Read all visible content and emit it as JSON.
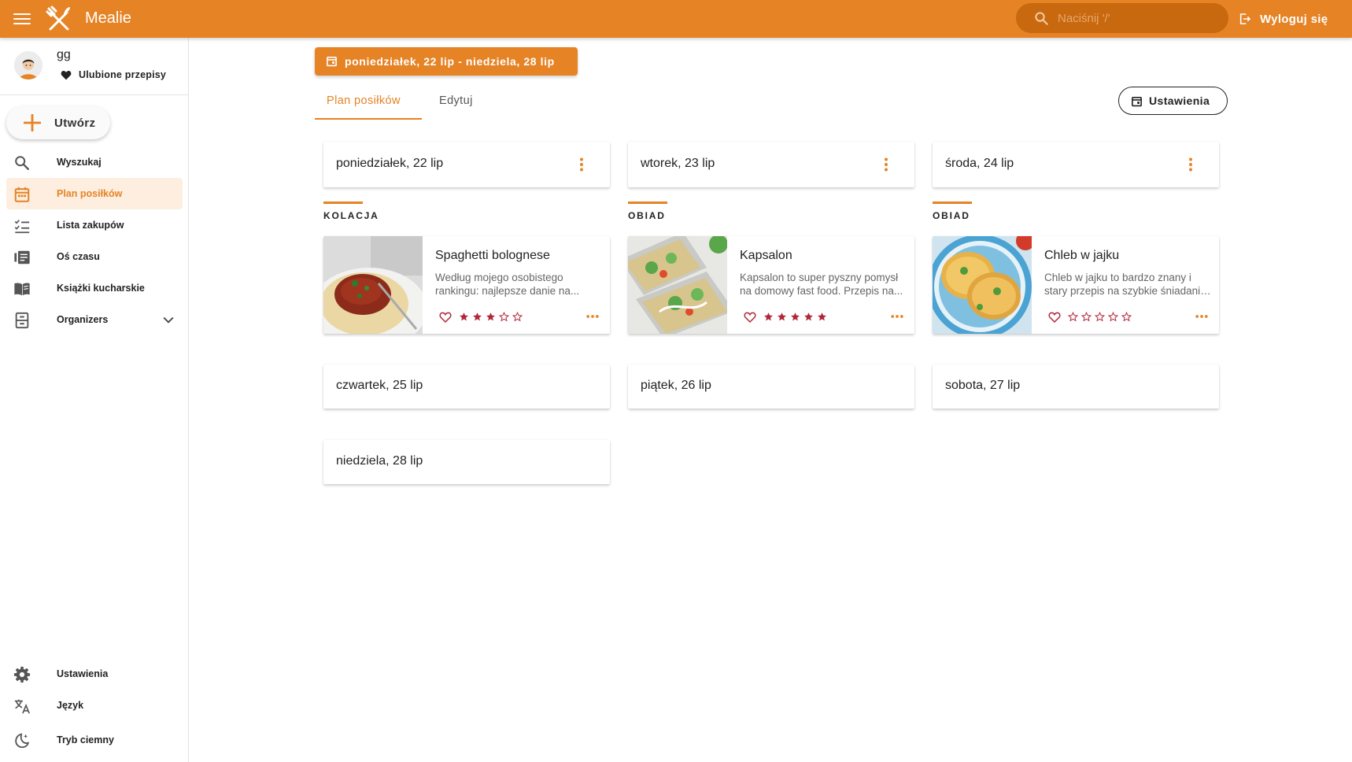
{
  "app": {
    "title": "Mealie"
  },
  "search": {
    "placeholder": "Naciśnij '/'"
  },
  "header": {
    "logout_label": "Wyloguj się"
  },
  "user": {
    "name": "gg",
    "favorites_label": "Ulubione przepisy"
  },
  "sidebar": {
    "create_label": "Utwórz",
    "items": [
      {
        "label": "Wyszukaj",
        "icon": "search-icon",
        "active": false
      },
      {
        "label": "Plan posiłków",
        "icon": "calendar-icon",
        "active": true
      },
      {
        "label": "Lista zakupów",
        "icon": "checklist-icon",
        "active": false
      },
      {
        "label": "Oś czasu",
        "icon": "timeline-icon",
        "active": false
      },
      {
        "label": "Książki kucharskie",
        "icon": "book-icon",
        "active": false
      },
      {
        "label": "Organizers",
        "icon": "organizer-icon",
        "active": false
      }
    ],
    "bottom_items": [
      {
        "label": "Ustawienia",
        "icon": "gear-icon"
      },
      {
        "label": "Język",
        "icon": "translate-icon"
      },
      {
        "label": "Tryb ciemny",
        "icon": "dark-mode-icon"
      }
    ]
  },
  "main": {
    "date_range": "poniedziałek, 22 lip - niedziela, 28 lip",
    "tabs": [
      {
        "label": "Plan posiłków",
        "active": true
      },
      {
        "label": "Edytuj",
        "active": false
      }
    ],
    "settings_label": "Ustawienia",
    "days": [
      {
        "label": "poniedziałek, 22 lip",
        "meal_type": "KOLACJA",
        "recipe": {
          "name": "Spaghetti bolognese",
          "desc_line1": "Według mojego osobistego",
          "desc_line2": "rankingu: najlepsze danie na...",
          "rating": 3
        }
      },
      {
        "label": "wtorek, 23 lip",
        "meal_type": "OBIAD",
        "recipe": {
          "name": "Kapsalon",
          "desc_line1": "Kapsalon to super pyszny pomysł",
          "desc_line2": "na domowy fast food. Przepis na...",
          "rating": 5
        }
      },
      {
        "label": "środa, 24 lip",
        "meal_type": "OBIAD",
        "recipe": {
          "name": "Chleb w jajku",
          "desc_line1": "Chleb w jajku to bardzo znany i",
          "desc_line2": "stary przepis na szybkie śniadanie...",
          "rating": 0
        }
      },
      {
        "label": "czwartek, 25 lip"
      },
      {
        "label": "piątek, 26 lip"
      },
      {
        "label": "sobota, 27 lip"
      },
      {
        "label": "niedziela, 28 lip"
      }
    ]
  },
  "colors": {
    "accent": "#e58325",
    "accent_dark": "#c8680f",
    "star": "#b0273a",
    "active_bg": "#fdeee0"
  }
}
